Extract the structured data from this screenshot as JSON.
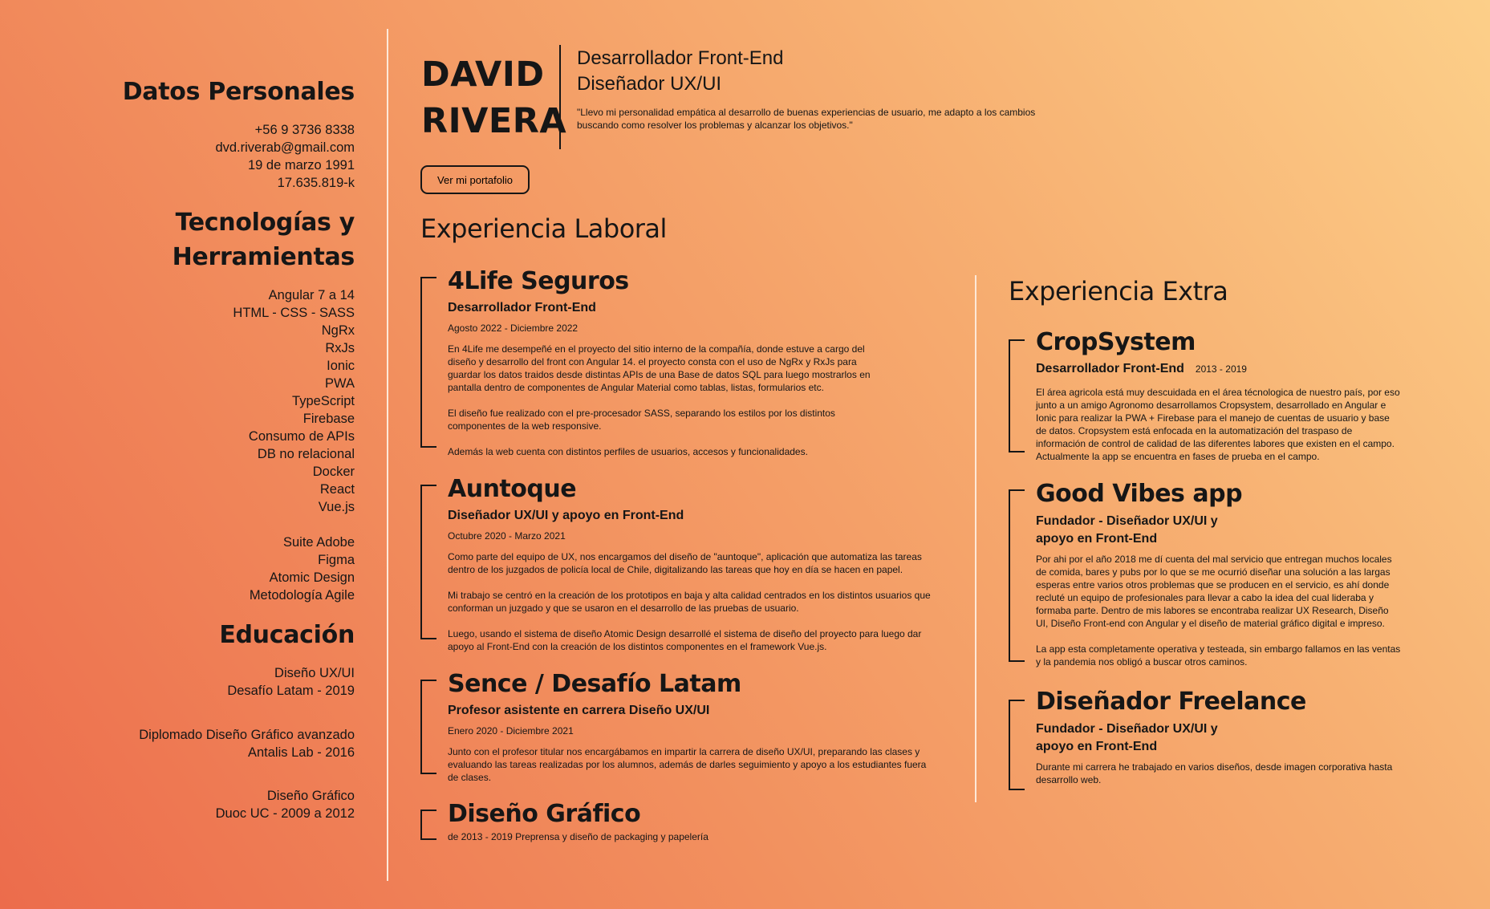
{
  "sidebar": {
    "personal": {
      "title": "Datos Personales",
      "phone": "+56 9 3736 8338",
      "email": "dvd.riverab@gmail.com",
      "birthdate": "19 de marzo 1991",
      "id": "17.635.819-k"
    },
    "tech": {
      "title_line1": "Tecnologías y",
      "title_line2": "Herramientas",
      "items": [
        "Angular 7 a 14",
        "HTML - CSS - SASS",
        "NgRx",
        "RxJs",
        "Ionic",
        "PWA",
        "TypeScript",
        "Firebase",
        "Consumo de APIs",
        "DB no relacional",
        "Docker",
        "React",
        "Vue.js"
      ],
      "items2": [
        "Suite Adobe",
        "Figma",
        "Atomic Design",
        "Metodología Agile"
      ]
    },
    "education": {
      "title": "Educación",
      "entries": [
        {
          "line1": "Diseño UX/UI",
          "line2": "Desafío Latam - 2019"
        },
        {
          "line1": "Diplomado Diseño Gráfico avanzado",
          "line2": "Antalis Lab - 2016"
        },
        {
          "line1": "Diseño Gráfico",
          "line2": "Duoc UC - 2009 a 2012"
        }
      ]
    }
  },
  "header": {
    "first_name": "DAVID",
    "last_name": "RIVERA",
    "role1": "Desarrollador Front-End",
    "role2": "Diseñador UX/UI",
    "quote_line1": "\"Llevo mi personalidad empática al desarrollo de buenas experiencias de usuario, me adapto a los cambios",
    "quote_line2": "buscando como resolver los problemas y alcanzar los objetivos.\"",
    "portfolio_button": "Ver mi portafolio"
  },
  "experience": {
    "title": "Experiencia Laboral",
    "jobs": [
      {
        "company": "4Life Seguros",
        "role": "Desarrollador Front-End",
        "date": "Agosto 2022 - Diciembre 2022",
        "paragraphs": [
          "En 4Life me desempeñé en el proyecto del sitio interno de la compañía, donde estuve a cargo del diseño y desarrollo del front con Angular 14. el proyecto consta con el uso de NgRx y RxJs para guardar los datos traidos desde distintas APIs de una Base de datos SQL para luego mostrarlos en pantalla dentro de componentes de Angular Material como tablas, listas, formularios etc.",
          "El diseño fue realizado con el pre-procesador SASS, separando los estilos por los distintos componentes de la web responsive.",
          "Además la web cuenta con distintos perfiles de usuarios, accesos y funcionalidades."
        ]
      },
      {
        "company": "Auntoque",
        "role": "Diseñador UX/UI y apoyo en Front-End",
        "date": "Octubre 2020 - Marzo 2021",
        "paragraphs": [
          "Como parte del equipo de UX, nos encargamos del diseño de \"auntoque\", aplicación que automatiza las tareas dentro de los juzgados de policía local de Chile, digitalizando las tareas que hoy en día se hacen en papel.",
          "Mi trabajo se centró en la creación de los prototipos en baja y alta calidad centrados en los distintos usuarios que conforman un juzgado y que se usaron en el desarrollo de las pruebas de usuario.",
          "Luego, usando el sistema de diseño Atomic Design desarrollé el sistema de diseño del proyecto para luego dar apoyo al Front-End con la creación de los distintos componentes en el framework Vue.js."
        ]
      },
      {
        "company": "Sence / Desafío Latam",
        "role": "Profesor asistente en carrera Diseño UX/UI",
        "date": "Enero 2020 - Diciembre 2021",
        "paragraphs": [
          "Junto con el profesor titular nos encargábamos en impartir la carrera de diseño UX/UI, preparando las clases y evaluando las tareas realizadas por los alumnos, además de darles seguimiento y apoyo a los estudiantes fuera de clases."
        ]
      },
      {
        "company": "Diseño Gráfico",
        "date": "de 2013 - 2019 Preprensa y diseño de packaging y papelería"
      }
    ]
  },
  "extra": {
    "title": "Experiencia Extra",
    "jobs": [
      {
        "company": "CropSystem",
        "role": "Desarrollador Front-End",
        "date": "2013 - 2019",
        "paragraphs": [
          "El área agricola está muy descuidada en el área técnologica de nuestro país, por eso junto a un amigo Agronomo desarrollamos Cropsystem, desarrollado en Angular e Ionic para realizar la PWA + Firebase para el manejo de cuentas de usuario y base de datos. Cropsystem está enfocada en la automatización del traspaso de información de control de calidad de las diferentes labores que existen en el campo. Actualmente la app se encuentra en fases de prueba en el campo."
        ]
      },
      {
        "company": "Good Vibes app",
        "role_line1": "Fundador - Diseñador UX/UI y",
        "role_line2": "apoyo en Front-End",
        "paragraphs": [
          "Por ahi por el año 2018 me dí cuenta del mal servicio que entregan muchos locales de comida, bares y pubs por lo que se me ocurrió diseñar una solución a las largas esperas entre varios otros problemas que se producen en el servicio, es ahí donde recluté un equipo de profesionales para llevar a cabo la idea del cual lideraba y formaba parte. Dentro de mis labores se encontraba realizar UX Research, Diseño UI, Diseño Front-end con Angular y el diseño de material gráfico digital e impreso.",
          "La app esta completamente operativa y testeada, sin embargo fallamos en las ventas y la pandemia nos obligó a buscar otros caminos."
        ]
      },
      {
        "company": "Diseñador Freelance",
        "role_line1": "Fundador - Diseñador UX/UI y",
        "role_line2": "apoyo en Front-End",
        "paragraphs": [
          "Durante mi carrera he trabajado en varios diseños, desde imagen corporativa hasta desarrollo web."
        ]
      }
    ]
  }
}
